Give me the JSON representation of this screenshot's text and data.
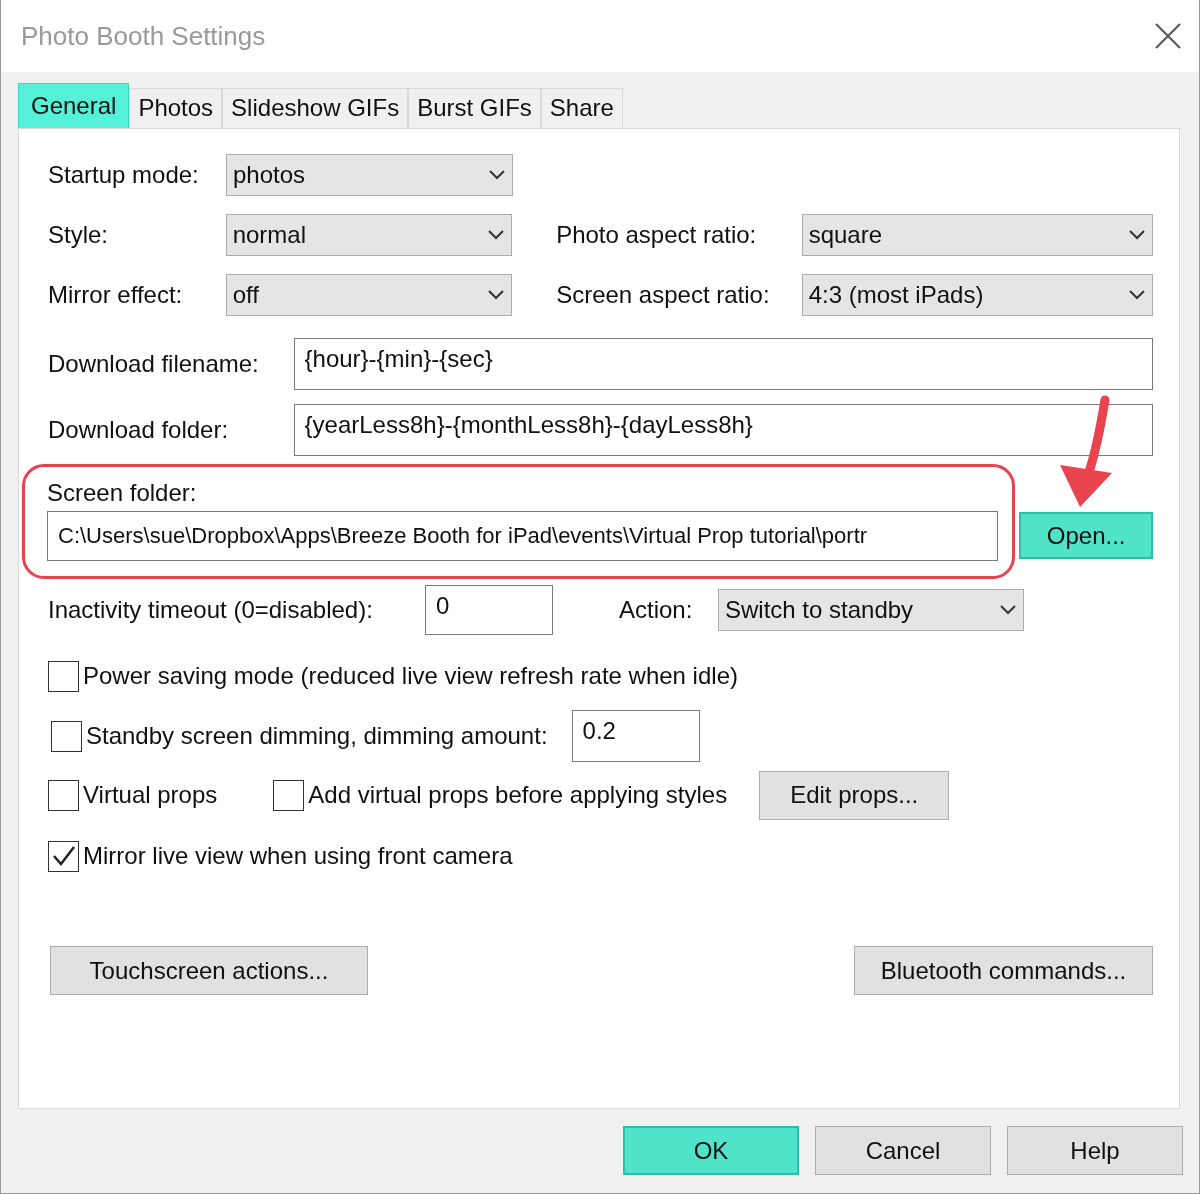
{
  "window": {
    "title": "Photo Booth Settings"
  },
  "tabs": [
    {
      "label": "General",
      "selected": true
    },
    {
      "label": "Photos",
      "selected": false
    },
    {
      "label": "Slideshow GIFs",
      "selected": false
    },
    {
      "label": "Burst GIFs",
      "selected": false
    },
    {
      "label": "Share",
      "selected": false
    }
  ],
  "startup_mode": {
    "label": "Startup mode:",
    "value": "photos"
  },
  "style": {
    "label": "Style:",
    "value": "normal"
  },
  "photo_aspect_ratio": {
    "label": "Photo aspect ratio:",
    "value": "square"
  },
  "mirror_effect": {
    "label": "Mirror effect:",
    "value": "off"
  },
  "screen_aspect_ratio": {
    "label": "Screen aspect ratio:",
    "value": "4:3 (most iPads)"
  },
  "download_filename": {
    "label": "Download filename:",
    "value": "{hour}-{min}-{sec}"
  },
  "download_folder": {
    "label": "Download folder:",
    "value": "{yearLess8h}-{monthLess8h}-{dayLess8h}"
  },
  "screen_folder": {
    "label": "Screen folder:",
    "value": "C:\\Users\\sue\\Dropbox\\Apps\\Breeze Booth for iPad\\events\\Virtual Prop tutorial\\portr",
    "button": "Open...",
    "button_default": true
  },
  "inactivity_timeout": {
    "label": "Inactivity timeout (0=disabled):",
    "value": "0"
  },
  "action": {
    "label": "Action:",
    "value": "Switch to standby"
  },
  "power_saving": {
    "label": "Power saving mode (reduced live view refresh rate when idle)",
    "checked": false
  },
  "standby_dimming": {
    "label": "Standby screen dimming, dimming amount:",
    "checked": false,
    "value": "0.2"
  },
  "virtual_props": {
    "label": "Virtual props",
    "checked": false
  },
  "add_virtual_props": {
    "label": "Add virtual props before applying styles",
    "checked": false
  },
  "edit_props_button": "Edit props...",
  "mirror_live_view": {
    "label": "Mirror live view when using front camera",
    "checked": true
  },
  "touchscreen_button": "Touchscreen actions...",
  "bluetooth_button": "Bluetooth commands...",
  "footer_buttons": [
    {
      "label": "OK",
      "default": true
    },
    {
      "label": "Cancel",
      "default": false
    },
    {
      "label": "Help",
      "default": false
    }
  ]
}
